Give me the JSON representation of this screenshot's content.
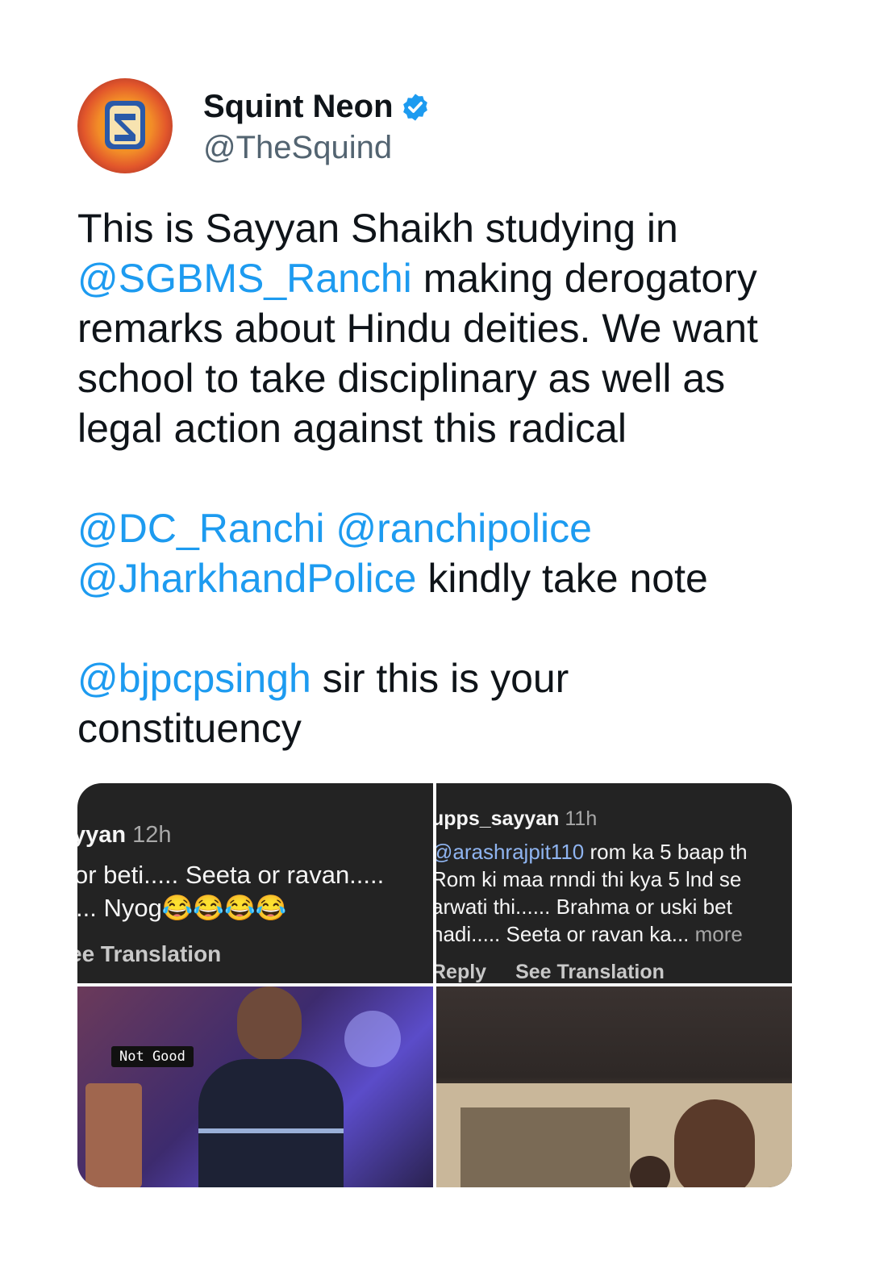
{
  "account": {
    "display_name": "Squint Neon",
    "handle": "@TheSquind",
    "verified": true,
    "avatar_icon": "squint-neon-logo-icon",
    "verified_icon": "verified-badge-icon",
    "verified_color": "#1d9bf0"
  },
  "tweet": {
    "p1": [
      {
        "text": "This is Sayyan Shaikh studying in ",
        "mention": false
      },
      {
        "text": "@SGBMS_Ranchi",
        "mention": true
      },
      {
        "text": " making derogatory remarks about Hindu deities. We want school to take disciplinary as well as legal action against this radical",
        "mention": false
      }
    ],
    "p2": [
      {
        "text": "@DC_Ranchi",
        "mention": true
      },
      {
        "text": " ",
        "mention": false
      },
      {
        "text": "@ranchipolice",
        "mention": true
      },
      {
        "text": " ",
        "mention": false
      },
      {
        "text": "@JharkhandPolice",
        "mention": true
      },
      {
        "text": " kindly take note",
        "mention": false
      }
    ],
    "p3": [
      {
        "text": "@bjpcpsingh",
        "mention": true
      },
      {
        "text": " sir this is your constituency",
        "mention": false
      }
    ],
    "mention_color": "#1d9bf0"
  },
  "media": {
    "img1": {
      "user": "yyan",
      "time": "12h",
      "line2": "or beti..... Seeta or ravan.....",
      "line3": "... Nyog😂😂😂😂",
      "action": "ee Translation"
    },
    "img2": {
      "user": "upps_sayyan",
      "time": "11h",
      "tag": "@arashrajpit110",
      "line2_rest": " rom ka 5 baap th",
      "line3": "Rom ki maa rnndi thi kya 5 lnd se",
      "line4": "arwati thi...... Brahma or uski bet",
      "line5_text": "hadi..... Seeta or ravan ka...",
      "line5_more": " more",
      "reply": "Reply",
      "translate": "See Translation"
    },
    "img3": {
      "sticker": "Not Good"
    }
  }
}
